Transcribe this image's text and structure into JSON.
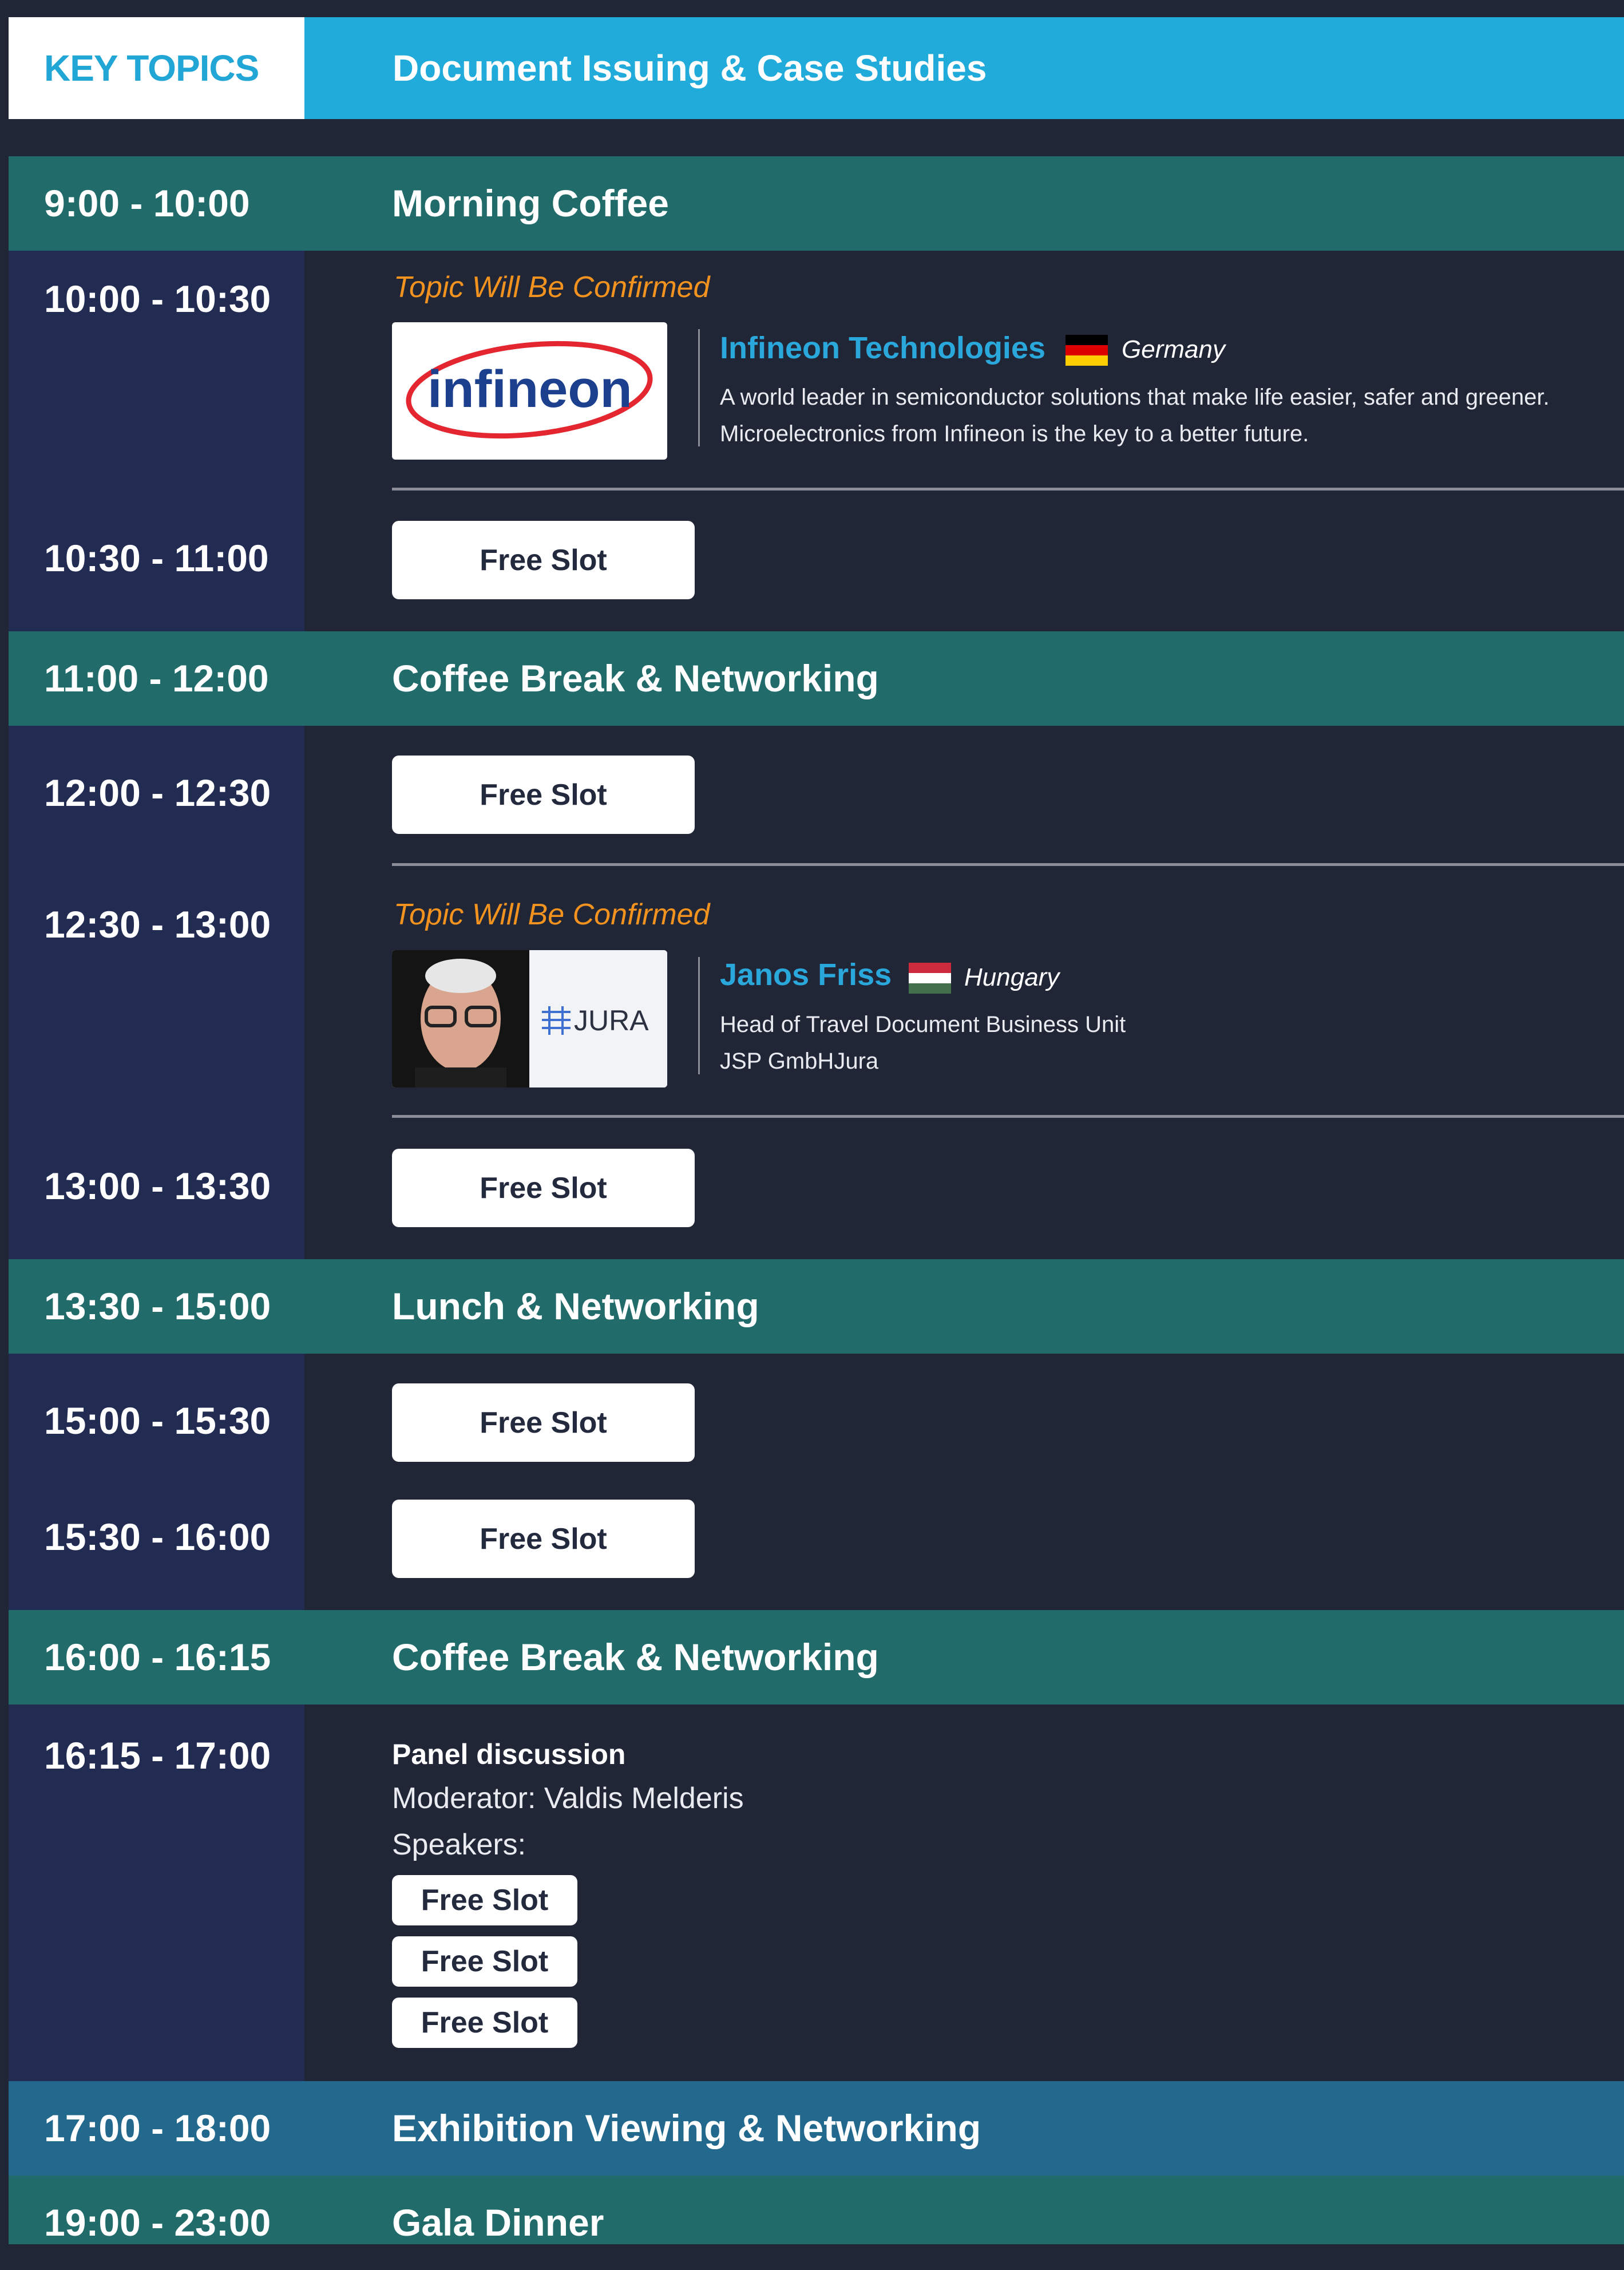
{
  "header": {
    "key_topics": "KEY TOPICS",
    "track_title": "Document Issuing & Case Studies"
  },
  "bands": [
    {
      "time": "9:00 - 10:00",
      "title": "Morning Coffee"
    },
    {
      "time": "11:00 - 12:00",
      "title": "Coffee Break & Networking"
    },
    {
      "time": "13:30 - 15:00",
      "title": "Lunch & Networking"
    },
    {
      "time": "16:00 - 16:15",
      "title": "Coffee Break & Networking"
    },
    {
      "time": "17:00 - 18:00",
      "title": "Exhibition Viewing & Networking"
    },
    {
      "time": "19:00 - 23:00",
      "title": "Gala Dinner"
    }
  ],
  "slots": {
    "s1000": {
      "time": "10:00 - 10:30",
      "topic": "Topic Will Be Confirmed",
      "logo_text": "infineon",
      "name": "Infineon Technologies",
      "country": "Germany",
      "desc_line1": "A world leader in semiconductor solutions that make life easier, safer and greener.",
      "desc_line2": "Microelectronics from Infineon is the key to a better future."
    },
    "s1030": {
      "time": "10:30 - 11:00",
      "button": "Free Slot"
    },
    "s1200": {
      "time": "12:00 - 12:30",
      "button": "Free Slot"
    },
    "s1230": {
      "time": "12:30 - 13:00",
      "topic": "Topic Will Be Confirmed",
      "logo_text": "JURA",
      "name": "Janos Friss",
      "country": "Hungary",
      "desc_line1": "Head of Travel Document Business Unit",
      "desc_line2": "JSP GmbHJura"
    },
    "s1300": {
      "time": "13:00 - 13:30",
      "button": "Free Slot"
    },
    "s1500": {
      "time": "15:00 - 15:30",
      "button": "Free Slot"
    },
    "s1530": {
      "time": "15:30 - 16:00",
      "button": "Free Slot"
    },
    "s1615": {
      "time": "16:15 - 17:00",
      "panel_title": "Panel discussion",
      "moderator": "Moderator: Valdis Melderis",
      "speakers_label": "Speakers:",
      "speakers": [
        "Free Slot",
        "Free Slot",
        "Free Slot"
      ]
    }
  },
  "colors": {
    "background": "#212637",
    "time_column": "#222c52",
    "band": "#226b6b",
    "band_blue": "#22698d",
    "header_blue": "#21abdb",
    "accent_orange": "#f3931f",
    "link_blue": "#2aa8dc"
  }
}
